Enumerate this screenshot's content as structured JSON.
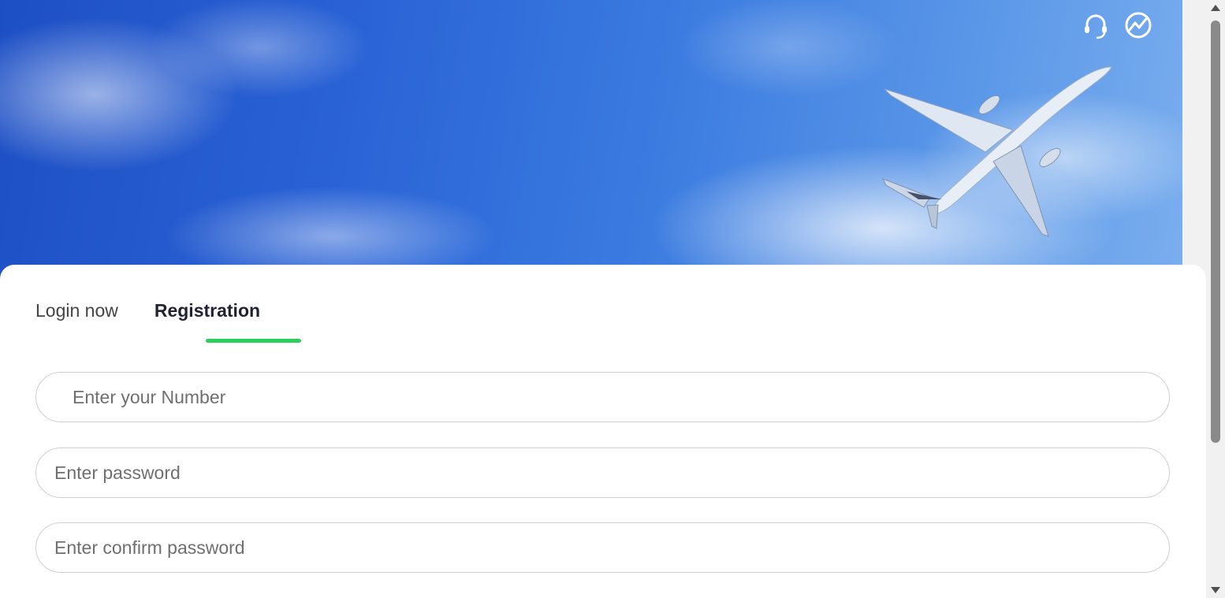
{
  "header": {
    "icons": [
      "headset-icon",
      "trend-chart-icon"
    ]
  },
  "tabs": [
    {
      "label": "Login now",
      "active": false
    },
    {
      "label": "Registration",
      "active": true
    }
  ],
  "form": {
    "number_placeholder": "Enter your Number",
    "password_placeholder": "Enter password",
    "confirm_placeholder": "Enter confirm password"
  },
  "colors": {
    "accent": "#27d15c",
    "active_tab_text": "#1f2230",
    "sky": "#2a63d6"
  }
}
